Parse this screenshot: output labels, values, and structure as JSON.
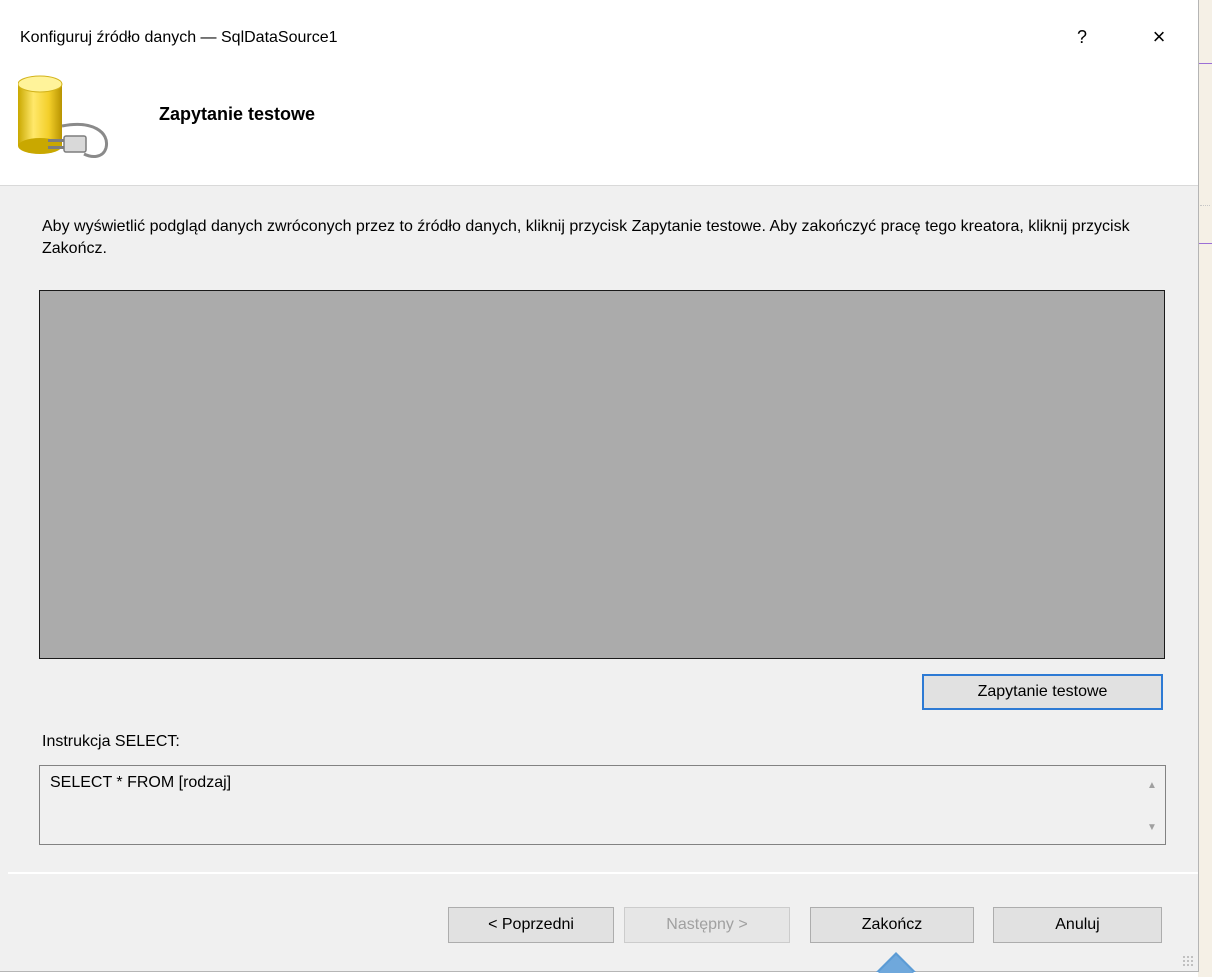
{
  "window": {
    "title": "Konfiguruj źródło danych — SqlDataSource1",
    "help_label": "?",
    "close_label": "×"
  },
  "header": {
    "icon": "database-plug-icon",
    "title": "Zapytanie testowe"
  },
  "main": {
    "description": "Aby wyświetlić podgląd danych zwróconych przez to źródło danych, kliknij przycisk Zapytanie testowe. Aby zakończyć pracę tego kreatora, kliknij przycisk Zakończ.",
    "test_query_button": "Zapytanie testowe",
    "select_label": "Instrukcja SELECT:",
    "select_statement": "SELECT * FROM [rodzaj]",
    "scroll_up_icon": "chevron-up-icon",
    "scroll_down_icon": "chevron-down-icon"
  },
  "footer": {
    "prev_button": "< Poprzedni",
    "next_button": "Następny >",
    "finish_button": "Zakończ",
    "cancel_button": "Anuluj"
  },
  "colors": {
    "grid_background": "#ababab",
    "focus_border": "#2d7ad4",
    "dialog_background": "#f0f0f0"
  }
}
